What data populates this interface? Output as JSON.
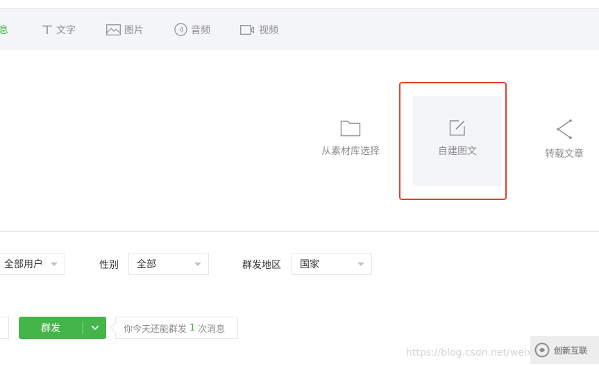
{
  "tabs": [
    {
      "label": "息",
      "icon": "message-icon",
      "active": true
    },
    {
      "label": "文字",
      "icon": "text-icon",
      "active": false
    },
    {
      "label": "图片",
      "icon": "image-icon",
      "active": false
    },
    {
      "label": "音频",
      "icon": "audio-icon",
      "active": false
    },
    {
      "label": "视频",
      "icon": "video-icon",
      "active": false
    }
  ],
  "compose_options": [
    {
      "label": "从素材库选择",
      "icon": "folder-icon"
    },
    {
      "label": "自建图文",
      "icon": "edit-icon",
      "highlighted": true
    },
    {
      "label": "转载文章",
      "icon": "share-icon"
    }
  ],
  "filters": {
    "audience": {
      "value": "全部用户"
    },
    "gender": {
      "label": "性别",
      "value": "全部"
    },
    "region": {
      "label": "群发地区",
      "value": "国家"
    }
  },
  "send": {
    "button_label": "群发",
    "quota_prefix": "你今天还能群发",
    "quota_count": "1",
    "quota_suffix": "次消息"
  },
  "watermark": {
    "url": "https://blog.csdn.net/weix",
    "brand": "创新互联"
  },
  "colors": {
    "accent": "#44b549",
    "highlight_border": "#e0402b",
    "tab_bar_bg": "#f4f5f9",
    "muted_text": "#8d8d8d"
  }
}
